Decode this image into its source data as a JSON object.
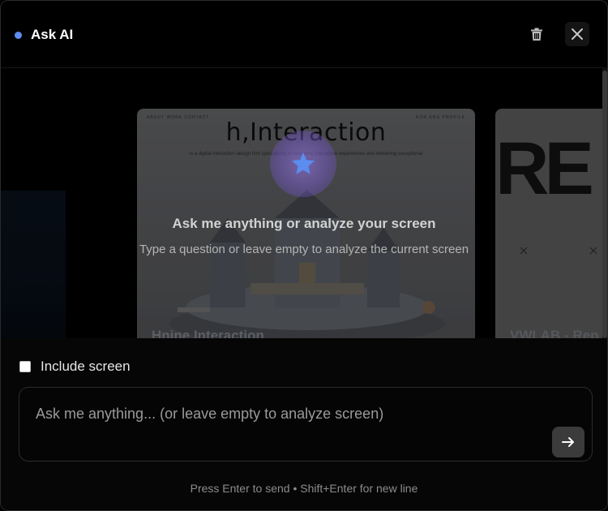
{
  "header": {
    "title": "Ask AI",
    "status_color": "#5b8def",
    "delete_icon": "trash-icon",
    "close_icon": "close-icon"
  },
  "cards": [
    {
      "logo": "h,Interaction",
      "nav_left": "ABOUT  WORK  CONTACT",
      "nav_right": "KOR  ENG  PROFILE",
      "tagline": "is a digital interaction design firm specializing in designing interactive experiences and delivering exceptional results",
      "label": "Hnine Interaction"
    },
    {
      "logo": "RE",
      "label": "VWLAB - Rep"
    }
  ],
  "overlay": {
    "icon": "sparkle-icon",
    "accent_color": "#5b8def",
    "heading": "Ask me anything or analyze your screen",
    "subtext": "Type a question or leave empty to analyze the current screen"
  },
  "composer": {
    "include_screen_label": "Include screen",
    "include_screen_checked": false,
    "placeholder": "Ask me anything... (or leave empty to analyze screen)",
    "send_icon": "arrow-right-icon",
    "hint": "Press Enter to send • Shift+Enter for new line"
  }
}
